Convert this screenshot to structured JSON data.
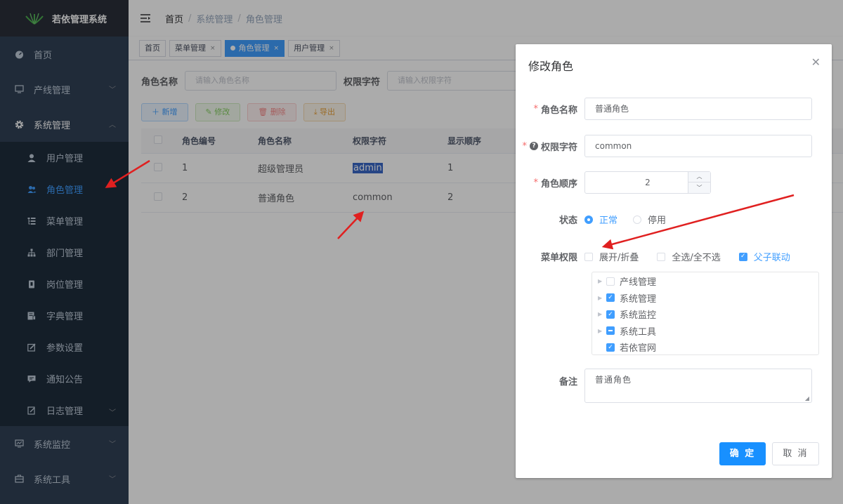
{
  "sidebar": {
    "logo_text": "若依管理系统",
    "items": [
      {
        "label": "首页",
        "icon": "dashboard-icon"
      },
      {
        "label": "产线管理",
        "icon": "monitor-icon"
      },
      {
        "label": "系统管理",
        "icon": "gear-icon"
      }
    ],
    "sub_items": [
      {
        "label": "用户管理",
        "icon": "user-icon"
      },
      {
        "label": "角色管理",
        "icon": "peoples-icon"
      },
      {
        "label": "菜单管理",
        "icon": "tree-table-icon"
      },
      {
        "label": "部门管理",
        "icon": "tree-icon"
      },
      {
        "label": "岗位管理",
        "icon": "post-icon"
      },
      {
        "label": "字典管理",
        "icon": "dict-icon"
      },
      {
        "label": "参数设置",
        "icon": "edit-icon"
      },
      {
        "label": "通知公告",
        "icon": "message-icon"
      },
      {
        "label": "日志管理",
        "icon": "log-icon"
      }
    ],
    "bottom_items": [
      {
        "label": "系统监控",
        "icon": "monitor-icon"
      },
      {
        "label": "系统工具",
        "icon": "tool-icon"
      }
    ]
  },
  "breadcrumb": {
    "home": "首页",
    "level1": "系统管理",
    "level2": "角色管理"
  },
  "tags": {
    "home": "首页",
    "menu": "菜单管理",
    "role": "角色管理",
    "user": "用户管理"
  },
  "search": {
    "role_name_label": "角色名称",
    "role_name_placeholder": "请输入角色名称",
    "role_key_label": "权限字符",
    "role_key_placeholder": "请输入权限字符"
  },
  "toolbar": {
    "add": "新增",
    "edit": "修改",
    "delete": "删除",
    "export": "导出"
  },
  "table": {
    "headers": [
      "角色编号",
      "角色名称",
      "权限字符",
      "显示顺序"
    ],
    "rows": [
      {
        "id": "1",
        "name": "超级管理员",
        "key": "admin",
        "sort": "1"
      },
      {
        "id": "2",
        "name": "普通角色",
        "key": "common",
        "sort": "2"
      }
    ]
  },
  "dialog": {
    "title": "修改角色",
    "role_name_label": "角色名称",
    "role_name_value": "普通角色",
    "role_key_label": "权限字符",
    "role_key_value": "common",
    "role_sort_label": "角色顺序",
    "role_sort_value": "2",
    "status_label": "状态",
    "status_options": [
      "正常",
      "停用"
    ],
    "status_selected": "正常",
    "menu_perm_label": "菜单权限",
    "menu_checks": [
      {
        "label": "展开/折叠",
        "checked": false
      },
      {
        "label": "全选/全不选",
        "checked": false
      },
      {
        "label": "父子联动",
        "checked": true
      }
    ],
    "tree": [
      {
        "label": "产线管理",
        "state": "unchecked",
        "expandable": true
      },
      {
        "label": "系统管理",
        "state": "checked",
        "expandable": true
      },
      {
        "label": "系统监控",
        "state": "checked",
        "expandable": true
      },
      {
        "label": "系统工具",
        "state": "indeterminate",
        "expandable": true
      },
      {
        "label": "若依官网",
        "state": "checked",
        "expandable": false
      }
    ],
    "remark_label": "备注",
    "remark_value": "普通角色",
    "confirm": "确 定",
    "cancel": "取 消"
  },
  "colors": {
    "primary": "#409eff",
    "sidebar_bg": "#304156",
    "annotation_arrow": "#e02020"
  }
}
